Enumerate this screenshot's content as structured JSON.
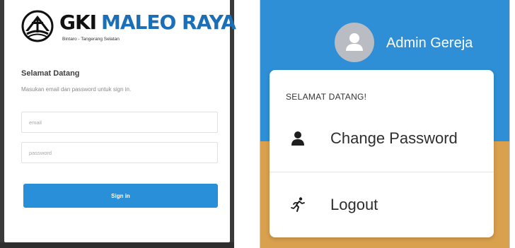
{
  "login": {
    "logo": {
      "word_gki": "GKI",
      "word_maleo": "MALEO RAYA",
      "subtitle": "Bintaro - Tangerang Selatan",
      "emblem": "church-emblem-icon"
    },
    "welcome_title": "Selamat Datang",
    "welcome_subtitle": "Masukan email dan password untuk sign in.",
    "email_placeholder": "email",
    "password_placeholder": "password",
    "signin_label": "Sign in",
    "colors": {
      "accent": "#2a8fd9",
      "brand_blue": "#1a6fb7"
    }
  },
  "header": {
    "user_name": "Admin Gereja",
    "avatar_icon": "user-avatar-icon",
    "colors": {
      "bar": "#2e8fd6",
      "banner": "#d9a04d"
    }
  },
  "dropdown": {
    "header": "SELAMAT DATANG!",
    "items": [
      {
        "label": "Change Password",
        "icon": "user-icon"
      },
      {
        "label": "Logout",
        "icon": "running-person-icon"
      }
    ]
  }
}
